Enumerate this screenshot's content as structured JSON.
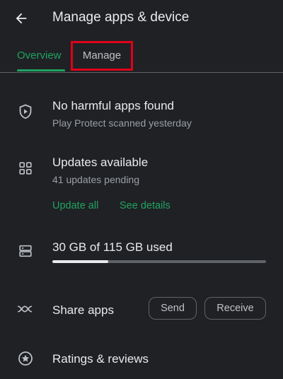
{
  "header": {
    "back_icon": "arrow-back-icon",
    "title": "Manage apps & device"
  },
  "tabs": [
    {
      "label": "Overview",
      "active": true
    },
    {
      "label": "Manage",
      "active": false,
      "highlighted": true
    }
  ],
  "play_protect": {
    "icon": "shield-play-icon",
    "title": "No harmful apps found",
    "subtitle": "Play Protect scanned yesterday"
  },
  "updates": {
    "icon": "grid-apps-icon",
    "title": "Updates available",
    "subtitle": "41 updates pending",
    "update_all_label": "Update all",
    "see_details_label": "See details"
  },
  "storage": {
    "icon": "storage-icon",
    "label": "30 GB of 115 GB used",
    "used_gb": 30,
    "total_gb": 115,
    "used_fraction": 0.26
  },
  "share": {
    "icon": "share-apps-icon",
    "label": "Share apps",
    "send_label": "Send",
    "receive_label": "Receive"
  },
  "ratings": {
    "icon": "star-circle-icon",
    "label": "Ratings & reviews"
  },
  "colors": {
    "background": "#202124",
    "accent": "#1ea362",
    "highlight_box": "#e0001b",
    "text_primary": "#e8eaed",
    "text_secondary": "#9aa0a6"
  }
}
